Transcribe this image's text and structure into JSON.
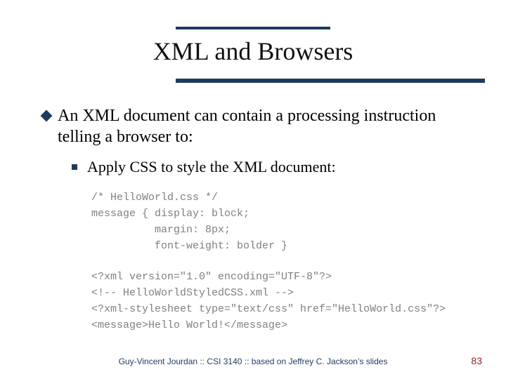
{
  "title": "XML and Browsers",
  "bullets": {
    "main": "An XML document can contain a processing instruction telling a browser to:",
    "sub": "Apply CSS to style the XML document:"
  },
  "code": {
    "css": "/* HelloWorld.css */\nmessage { display: block;\n          margin: 8px;\n          font-weight: bolder }",
    "xml": "<?xml version=\"1.0\" encoding=\"UTF-8\"?>\n<!-- HelloWorldStyledCSS.xml -->\n<?xml-stylesheet type=\"text/css\" href=\"HelloWorld.css\"?>\n<message>Hello World!</message>"
  },
  "footer": {
    "attribution": "Guy-Vincent Jourdan :: CSI 3140 :: based on Jeffrey C. Jackson’s slides",
    "page": "83"
  }
}
